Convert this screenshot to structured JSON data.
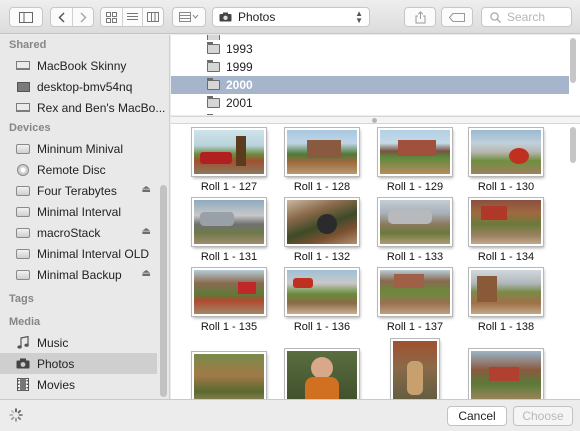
{
  "toolbar": {
    "location": "Photos",
    "search_placeholder": "Search"
  },
  "sidebar": {
    "sections": [
      {
        "title": "Shared",
        "items": [
          {
            "label": "MacBook Skinny",
            "icon": "laptop"
          },
          {
            "label": "desktop-bmv54nq",
            "icon": "monitor"
          },
          {
            "label": "Rex and Ben's MacBo...",
            "icon": "laptop"
          }
        ]
      },
      {
        "title": "Devices",
        "items": [
          {
            "label": "Mininum Minival",
            "icon": "disk",
            "eject": false
          },
          {
            "label": "Remote Disc",
            "icon": "disc",
            "eject": false
          },
          {
            "label": "Four Terabytes",
            "icon": "disk",
            "eject": true
          },
          {
            "label": "Minimal Interval",
            "icon": "disk",
            "eject": false
          },
          {
            "label": "macroStack",
            "icon": "disk",
            "eject": true
          },
          {
            "label": "Minimal Interval OLD",
            "icon": "disk",
            "eject": false
          },
          {
            "label": "Minimal Backup",
            "icon": "disk",
            "eject": true
          }
        ]
      },
      {
        "title": "Tags",
        "items": []
      },
      {
        "title": "Media",
        "items": [
          {
            "label": "Music",
            "icon": "music-note"
          },
          {
            "label": "Photos",
            "icon": "camera",
            "selected": true
          },
          {
            "label": "Movies",
            "icon": "film"
          }
        ]
      }
    ]
  },
  "folders": [
    {
      "label": "1993",
      "selected": false
    },
    {
      "label": "1999",
      "selected": false
    },
    {
      "label": "2000",
      "selected": true
    },
    {
      "label": "2001",
      "selected": false
    }
  ],
  "photos": [
    {
      "caption": "Roll 1 - 127"
    },
    {
      "caption": "Roll 1 - 128"
    },
    {
      "caption": "Roll 1 - 129"
    },
    {
      "caption": "Roll 1 - 130"
    },
    {
      "caption": "Roll 1 - 131"
    },
    {
      "caption": "Roll 1 - 132"
    },
    {
      "caption": "Roll 1 - 133"
    },
    {
      "caption": "Roll 1 - 134"
    },
    {
      "caption": "Roll 1 - 135"
    },
    {
      "caption": "Roll 1 - 136"
    },
    {
      "caption": "Roll 1 - 137"
    },
    {
      "caption": "Roll 1 - 138"
    }
  ],
  "footer": {
    "cancel_label": "Cancel",
    "choose_label": "Choose"
  },
  "colors": {
    "selection": "#a6b5cb",
    "sidebar_bg": "#e9e9e9"
  }
}
